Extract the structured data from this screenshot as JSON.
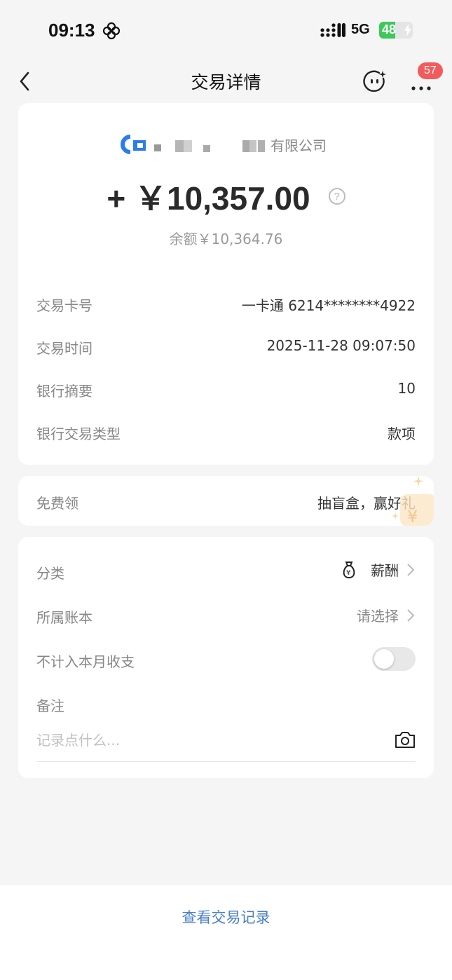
{
  "status_bar": {
    "time": "09:13",
    "network": "5G",
    "battery_level": 48,
    "battery_text": "48"
  },
  "nav": {
    "title": "交易详情",
    "badge_count": "57"
  },
  "summary": {
    "company_suffix": "有限公司",
    "amount": "+ ￥10,357.00",
    "help": "?",
    "balance": "余额￥10,364.76"
  },
  "details": [
    {
      "label": "交易卡号",
      "value": "一卡通 6214********4922"
    },
    {
      "label": "交易时间",
      "value": "2025-11-28 09:07:50"
    },
    {
      "label": "银行摘要",
      "value": "10"
    },
    {
      "label": "银行交易类型",
      "value": "款项"
    }
  ],
  "free": {
    "label": "免费领",
    "value": "抽盲盒，赢好礼"
  },
  "settings": {
    "category_label": "分类",
    "category_value": "薪酬",
    "ledger_label": "所属账本",
    "ledger_value": "请选择",
    "exclude_label": "不计入本月收支",
    "exclude_on": false,
    "memo_label": "备注",
    "memo_placeholder": "记录点什么..."
  },
  "footer": {
    "link": "查看交易记录"
  },
  "colors": {
    "accent_link": "#4a80c8",
    "badge": "#f25b5b",
    "battery": "#3cc85a"
  }
}
